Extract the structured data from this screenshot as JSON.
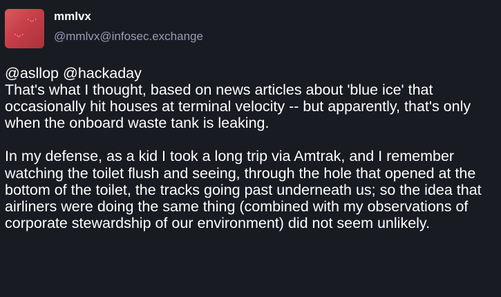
{
  "author": {
    "display_name": "mmlvx",
    "handle": "@mmlvx@infosec.exchange",
    "avatar_icon": "avatar-image"
  },
  "post": {
    "mentions": [
      "@asllop",
      "@hackaday"
    ],
    "paragraph1": "That's what I thought, based on news articles about 'blue ice' that occasionally hit houses at terminal velocity -- but apparently, that's only when the onboard waste tank is leaking.",
    "paragraph2": "In my defense, as a kid I took a long trip via Amtrak, and I remember watching the toilet flush and seeing, through the hole that opened at the bottom of the toilet, the tracks going past underneath us; so the idea that airliners were doing the same thing (combined with my observations of corporate stewardship of our environment) did not seem unlikely."
  },
  "colors": {
    "background": "#191b22",
    "text": "#ffffff",
    "handle": "#9a9ab7",
    "avatar": "#c73e47"
  }
}
